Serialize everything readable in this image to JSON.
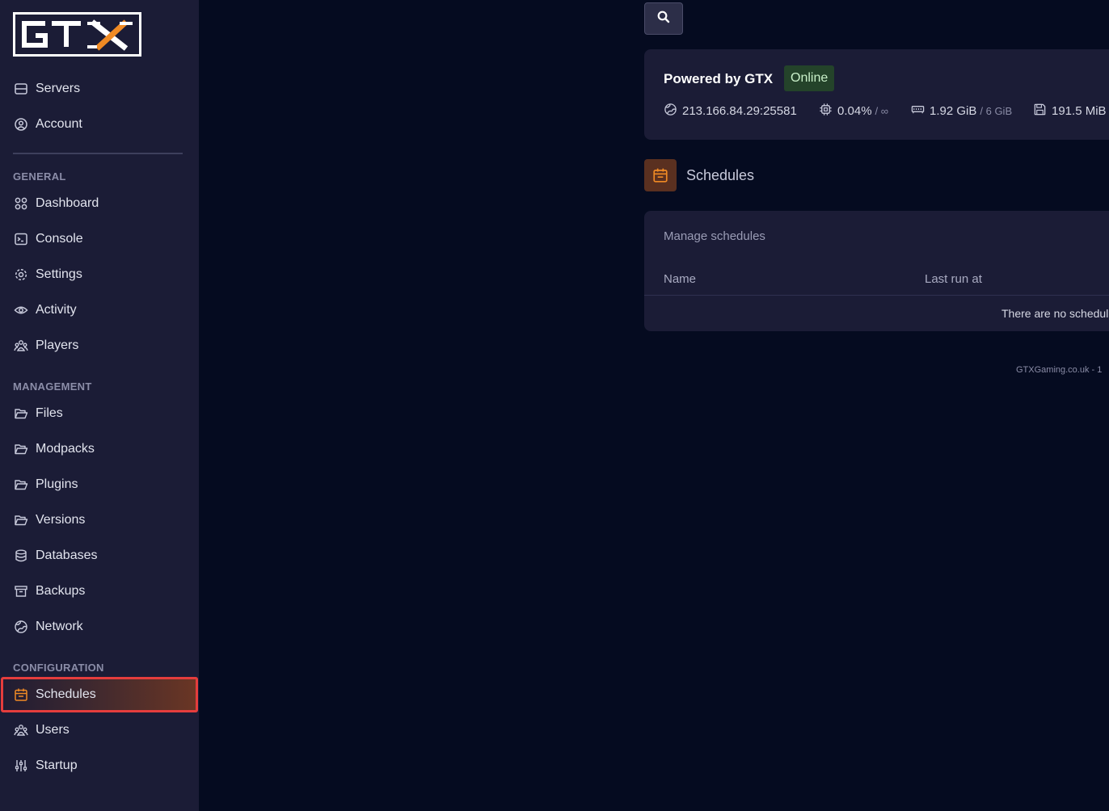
{
  "brand": {
    "logo_text": "GTX"
  },
  "sidebar": {
    "top_items": [
      {
        "label": "Servers",
        "icon": "server-icon"
      },
      {
        "label": "Account",
        "icon": "user-circle-icon"
      }
    ],
    "sections": [
      {
        "label": "GENERAL",
        "items": [
          {
            "label": "Dashboard",
            "icon": "grid-icon"
          },
          {
            "label": "Console",
            "icon": "terminal-icon"
          },
          {
            "label": "Settings",
            "icon": "gear-icon"
          },
          {
            "label": "Activity",
            "icon": "eye-icon"
          },
          {
            "label": "Players",
            "icon": "users-icon"
          }
        ]
      },
      {
        "label": "MANAGEMENT",
        "items": [
          {
            "label": "Files",
            "icon": "folder-icon"
          },
          {
            "label": "Modpacks",
            "icon": "folder-icon"
          },
          {
            "label": "Plugins",
            "icon": "folder-icon"
          },
          {
            "label": "Versions",
            "icon": "folder-icon"
          },
          {
            "label": "Databases",
            "icon": "database-icon"
          },
          {
            "label": "Backups",
            "icon": "archive-icon"
          },
          {
            "label": "Network",
            "icon": "globe-icon"
          }
        ]
      },
      {
        "label": "CONFIGURATION",
        "items": [
          {
            "label": "Schedules",
            "icon": "calendar-icon",
            "active": true
          },
          {
            "label": "Users",
            "icon": "users-icon"
          },
          {
            "label": "Startup",
            "icon": "sliders-icon"
          }
        ]
      }
    ]
  },
  "server": {
    "name": "Powered by GTX",
    "status": "Online",
    "address": "213.166.84.29:25581",
    "cpu": "0.04%",
    "cpu_limit": "/ ∞",
    "memory": "1.92 GiB",
    "memory_limit": "/ 6 GiB",
    "disk": "191.5 MiB"
  },
  "page": {
    "title": "Schedules",
    "card_title": "Manage schedules",
    "columns": [
      "Name",
      "Last run at"
    ],
    "empty_message": "There are no schedul"
  },
  "footer": {
    "text": "GTXGaming.co.uk - 1"
  },
  "colors": {
    "accent": "#f08a24",
    "sidebar_bg": "#1b1c36",
    "page_bg": "#050b20",
    "status_online": "#24432a",
    "active_outline": "#e53d3d"
  }
}
